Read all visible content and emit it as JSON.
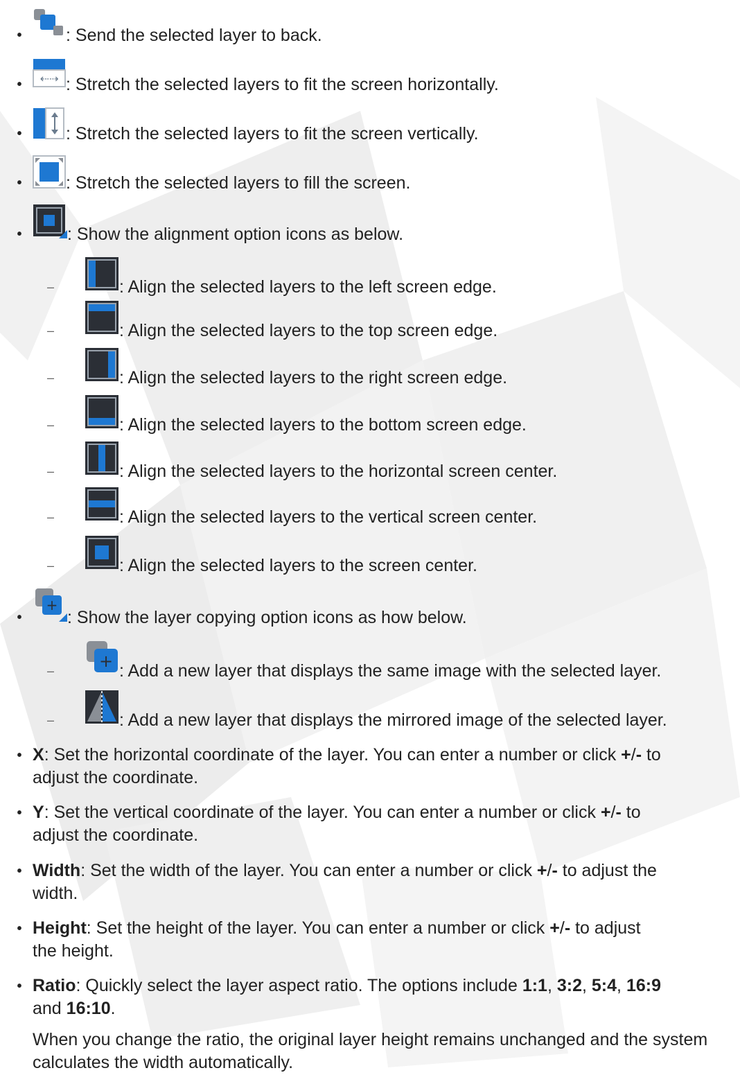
{
  "icon_items": [
    {
      "icon": "send-to-back-icon",
      "text": ": Send the selected layer to back."
    },
    {
      "icon": "stretch-horizontal-icon",
      "text": ": Stretch the selected layers to fit the screen horizontally."
    },
    {
      "icon": "stretch-vertical-icon",
      "text": ": Stretch the selected layers to fit the screen vertically."
    },
    {
      "icon": "stretch-fill-icon",
      "text": ": Stretch the selected layers to fill the screen."
    },
    {
      "icon": "alignment-options-icon",
      "text": ": Show the alignment option icons as below."
    }
  ],
  "align_items": [
    {
      "icon": "align-left-icon",
      "text": ": Align the selected layers to the left screen edge."
    },
    {
      "icon": "align-top-icon",
      "text": ": Align the selected layers to the top screen edge."
    },
    {
      "icon": "align-right-icon",
      "text": ": Align the selected layers to the right screen edge."
    },
    {
      "icon": "align-bottom-icon",
      "text": ": Align the selected layers to the bottom screen edge."
    },
    {
      "icon": "align-horizontal-center-icon",
      "text": ": Align the selected layers to the horizontal screen center."
    },
    {
      "icon": "align-vertical-center-icon",
      "text": ": Align the selected layers to the vertical screen center."
    },
    {
      "icon": "align-center-icon",
      "text": ": Align the selected layers to the screen center."
    }
  ],
  "copy_item": {
    "icon": "layer-copy-options-icon",
    "text": ": Show the layer copying option icons as how below."
  },
  "copy_sub_items": [
    {
      "icon": "copy-layer-icon",
      "text": ": Add a new layer that displays the same image with the selected layer."
    },
    {
      "icon": "mirror-layer-icon",
      "text": ": Add a new layer that displays the mirrored image of the selected layer."
    }
  ],
  "params": [
    {
      "term": "X",
      "line1": ": Set the horizontal coordinate of the layer. You can enter a number or click ",
      "pm_plus": "+",
      "pm_slash": "/",
      "pm_minus": "-",
      "line1_end": " to",
      "line2": "adjust the coordinate."
    },
    {
      "term": "Y",
      "line1": ": Set the vertical coordinate of the layer. You can enter a number or click ",
      "pm_plus": "+",
      "pm_slash": "/",
      "pm_minus": "-",
      "line1_end": " to",
      "line2": "adjust the coordinate."
    },
    {
      "term": "Width",
      "line1": ": Set the width of the layer. You can enter a number or click ",
      "pm_plus": "+",
      "pm_slash": "/",
      "pm_minus": "-",
      "line1_end": " to adjust the",
      "line2": "width."
    },
    {
      "term": "Height",
      "line1": ": Set the height of the layer. You can enter a number or click ",
      "pm_plus": "+",
      "pm_slash": "/",
      "pm_minus": "-",
      "line1_end": " to adjust",
      "line2": "the height."
    }
  ],
  "ratio": {
    "term": "Ratio",
    "line1": ": Quickly select the layer aspect ratio. The options include ",
    "opt1": "1:1",
    "comma": ", ",
    "opt2": "3:2",
    "opt3": "5:4",
    "opt4": "16:9",
    "line2_pre": "and ",
    "opt5": "16:10",
    "period": ".",
    "note": "When you change the ratio, the original layer height remains unchanged and the system calculates the width automatically."
  },
  "colors": {
    "accent_blue": "#1e78d2",
    "dark_icon": "#2b2f36",
    "gray_icon": "#8a8f96",
    "text": "#222222"
  }
}
